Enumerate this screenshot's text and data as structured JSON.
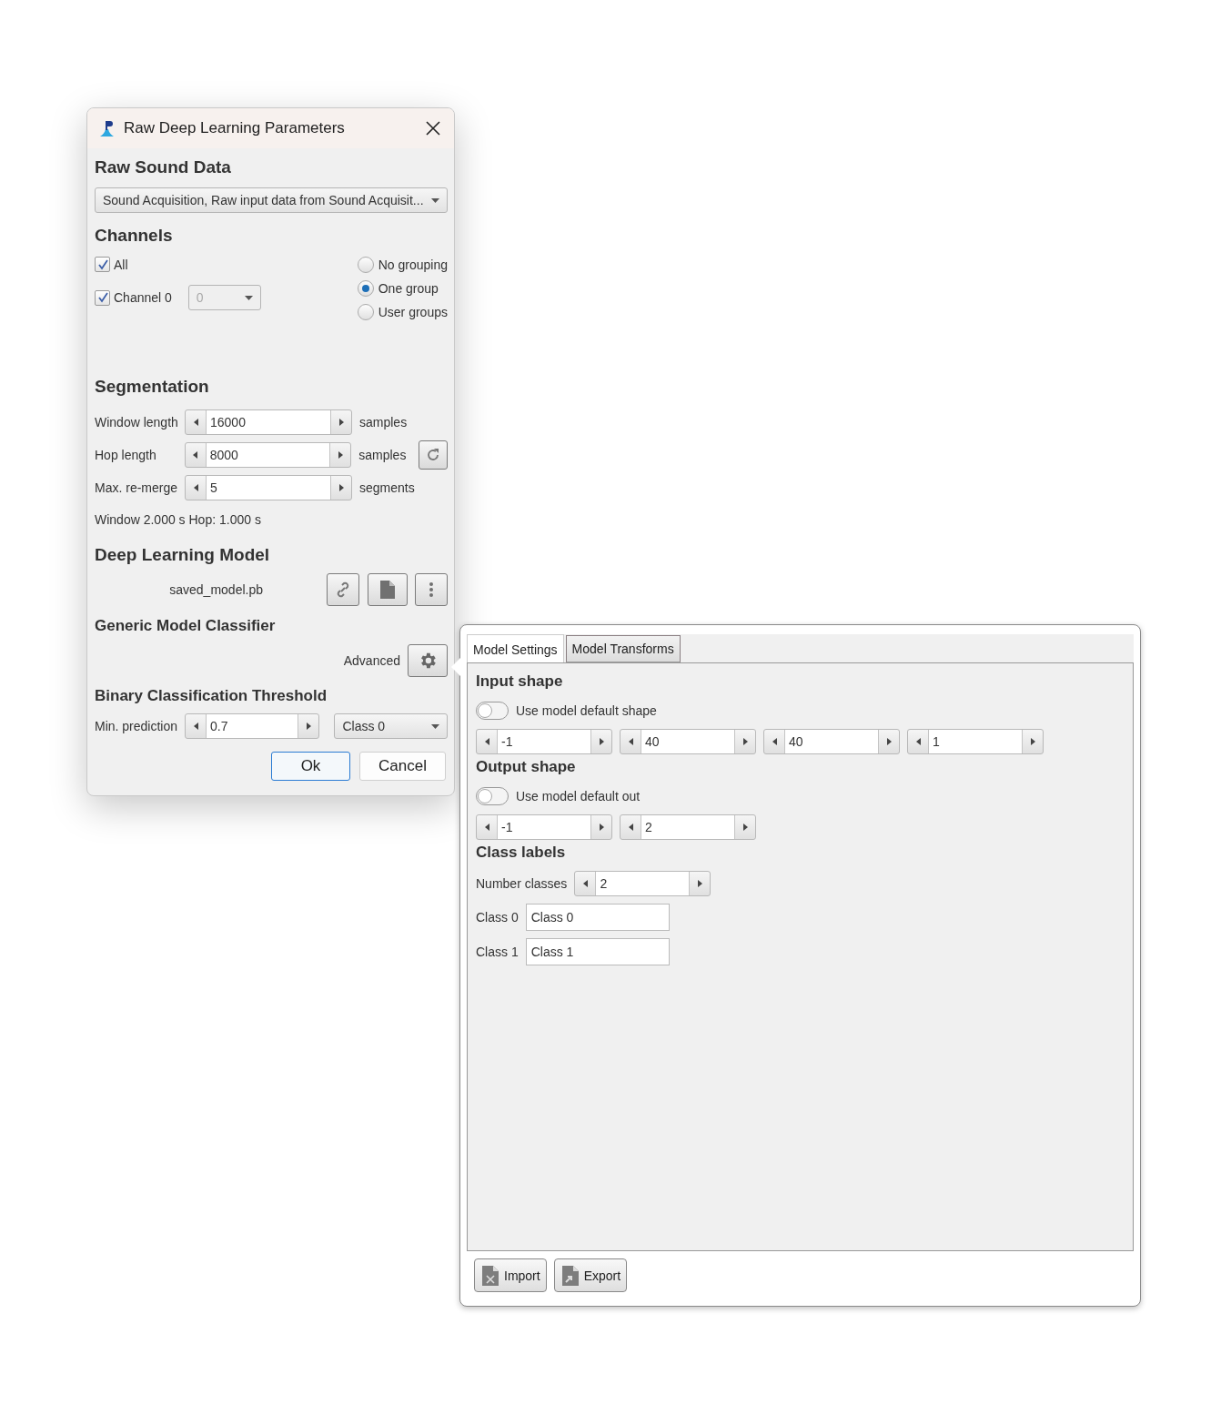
{
  "dialog": {
    "title": "Raw Deep Learning Parameters",
    "raw_sound_data": {
      "heading": "Raw Sound Data",
      "source": "Sound Acquisition, Raw input data from Sound Acquisit..."
    },
    "channels": {
      "heading": "Channels",
      "checkboxes": [
        {
          "label": "All",
          "checked": true
        },
        {
          "label": "Channel 0",
          "checked": true
        }
      ],
      "channel_select": {
        "value": "0",
        "disabled": true
      },
      "grouping": [
        {
          "label": "No grouping",
          "selected": false
        },
        {
          "label": "One group",
          "selected": true
        },
        {
          "label": "User groups",
          "selected": false
        }
      ]
    },
    "segmentation": {
      "heading": "Segmentation",
      "rows": [
        {
          "label": "Window length",
          "value": "16000",
          "unit": "samples",
          "reset_button": false
        },
        {
          "label": "Hop length",
          "value": "8000",
          "unit": "samples",
          "reset_button": true
        },
        {
          "label": "Max. re-merge",
          "value": "5",
          "unit": "segments",
          "reset_button": false
        }
      ],
      "summary": "Window 2.000 s Hop: 1.000 s"
    },
    "model": {
      "heading": "Deep Learning Model",
      "file": "saved_model.pb"
    },
    "classifier": {
      "heading": "Generic Model Classifier",
      "advanced_label": "Advanced"
    },
    "threshold": {
      "heading": "Binary Classification Threshold",
      "label": "Min. prediction",
      "value": "0.7",
      "class_select": "Class 0"
    },
    "buttons": [
      {
        "label": "Ok",
        "default": true
      },
      {
        "label": "Cancel",
        "default": false
      }
    ]
  },
  "advanced_panel": {
    "tabs": [
      {
        "label": "Model Settings",
        "selected": true
      },
      {
        "label": "Model Transforms",
        "selected": false
      }
    ],
    "input_shape": {
      "heading": "Input shape",
      "toggle": {
        "label": "Use model default shape",
        "on": false
      },
      "dims": [
        "-1",
        "40",
        "40",
        "1"
      ]
    },
    "output_shape": {
      "heading": "Output shape",
      "toggle": {
        "label": "Use model default out",
        "on": false
      },
      "dims": [
        "-1",
        "2"
      ]
    },
    "class_labels": {
      "heading": "Class labels",
      "count_label": "Number classes",
      "count": "2",
      "classes": [
        {
          "label": "Class 0",
          "value": "Class 0"
        },
        {
          "label": "Class 1",
          "value": "Class 1"
        }
      ]
    },
    "buttons": [
      {
        "label": "Import",
        "kind": "import"
      },
      {
        "label": "Export",
        "kind": "export"
      }
    ]
  }
}
